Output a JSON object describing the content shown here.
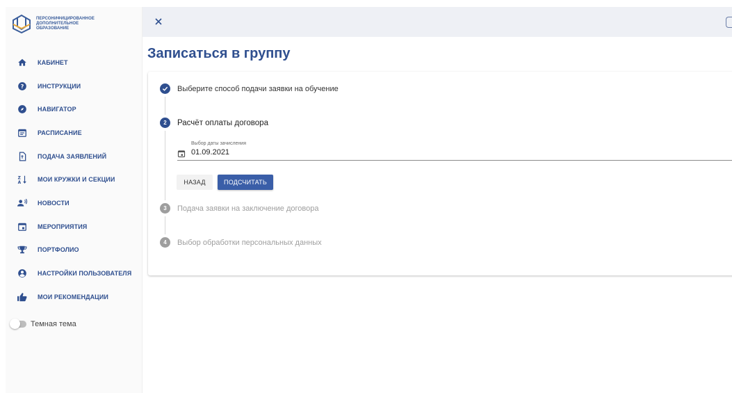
{
  "app": {
    "logo_lines": [
      "ПЕРСОНИФИЦИРОВАННОЕ",
      "ДОПОЛНИТЕЛЬНОЕ",
      "ОБРАЗОВАНИЕ"
    ]
  },
  "sidebar": {
    "items": [
      {
        "label": "КАБИНЕТ",
        "icon": "home-icon"
      },
      {
        "label": "ИНСТРУКЦИИ",
        "icon": "help-icon"
      },
      {
        "label": "НАВИГАТОР",
        "icon": "compass-icon"
      },
      {
        "label": "РАСПИСАНИЕ",
        "icon": "schedule-icon"
      },
      {
        "label": "ПОДАЧА ЗАЯВЛЕНИЙ",
        "icon": "file-upload-icon"
      },
      {
        "label": "МОИ КРУЖКИ И СЕКЦИИ",
        "icon": "sort-icon"
      },
      {
        "label": "НОВОСТИ",
        "icon": "announcement-icon"
      },
      {
        "label": "МЕРОПРИЯТИЯ",
        "icon": "event-icon"
      },
      {
        "label": "ПОРТФОЛИО",
        "icon": "trophy-icon"
      },
      {
        "label": "НАСТРОЙКИ ПОЛЬЗОВАТЕЛЯ",
        "icon": "account-icon"
      },
      {
        "label": "МОИ РЕКОМЕНДАЦИИ",
        "icon": "thumb-up-icon"
      }
    ],
    "theme_toggle": {
      "label": "Темная тема",
      "on": false
    }
  },
  "main": {
    "title": "Записаться в группу",
    "steps": [
      {
        "number": "",
        "label": "Выберите способ подачи заявки на обучение",
        "state": "done"
      },
      {
        "number": "2",
        "label": "Расчёт оплаты договора",
        "state": "active"
      },
      {
        "number": "3",
        "label": "Подача заявки на заключение договора",
        "state": "inactive"
      },
      {
        "number": "4",
        "label": "Выбор обработки персональных данных",
        "state": "inactive"
      }
    ],
    "date_field": {
      "label": "Выбор даты зачисления",
      "value": "01.09.2021"
    },
    "buttons": {
      "back": "НАЗАД",
      "calculate": "ПОДСЧИТАТЬ"
    }
  },
  "colors": {
    "accent": "#2f4f8f",
    "button_primary": "#3a5ea8",
    "topbar": "#eef0f5",
    "inactive": "#9e9e9e"
  }
}
